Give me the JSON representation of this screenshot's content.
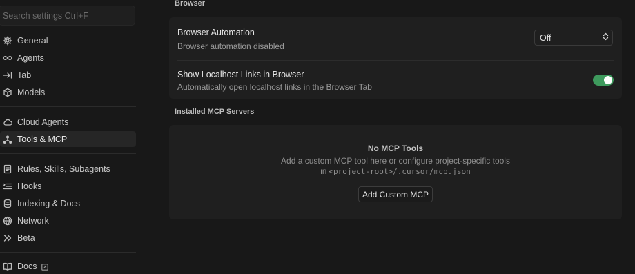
{
  "sidebar": {
    "search_placeholder": "Search settings Ctrl+F",
    "items": [
      {
        "label": "General",
        "icon": "gear-icon"
      },
      {
        "label": "Agents",
        "icon": "infinity-icon"
      },
      {
        "label": "Tab",
        "icon": "tab-arrow-icon"
      },
      {
        "label": "Models",
        "icon": "cube-icon"
      },
      {
        "label": "Cloud Agents",
        "icon": "cloud-icon"
      },
      {
        "label": "Tools & MCP",
        "icon": "nodes-icon"
      },
      {
        "label": "Rules, Skills, Subagents",
        "icon": "document-icon"
      },
      {
        "label": "Hooks",
        "icon": "list-icon"
      },
      {
        "label": "Indexing & Docs",
        "icon": "database-icon"
      },
      {
        "label": "Network",
        "icon": "globe-icon"
      },
      {
        "label": "Beta",
        "icon": "double-chevron-icon"
      },
      {
        "label": "Docs",
        "icon": "book-icon"
      }
    ],
    "active_item": "Tools & MCP"
  },
  "browser": {
    "section_title": "Browser",
    "automation": {
      "title": "Browser Automation",
      "description": "Browser automation disabled",
      "selected": "Off"
    },
    "localhost": {
      "title": "Show Localhost Links in Browser",
      "description": "Automatically open localhost links in the Browser Tab",
      "enabled": true
    }
  },
  "mcp": {
    "section_title": "Installed MCP Servers",
    "empty_title": "No MCP Tools",
    "empty_line1": "Add a custom MCP tool here or configure project-specific tools",
    "empty_line2_prefix": "in ",
    "empty_line2_path": "<project-root>/.cursor/mcp.json",
    "add_button": "Add Custom MCP"
  },
  "colors": {
    "background": "#181818",
    "card": "#1f1f1f",
    "toggle_on": "#3e9a5d",
    "active_nav": "#262626"
  }
}
